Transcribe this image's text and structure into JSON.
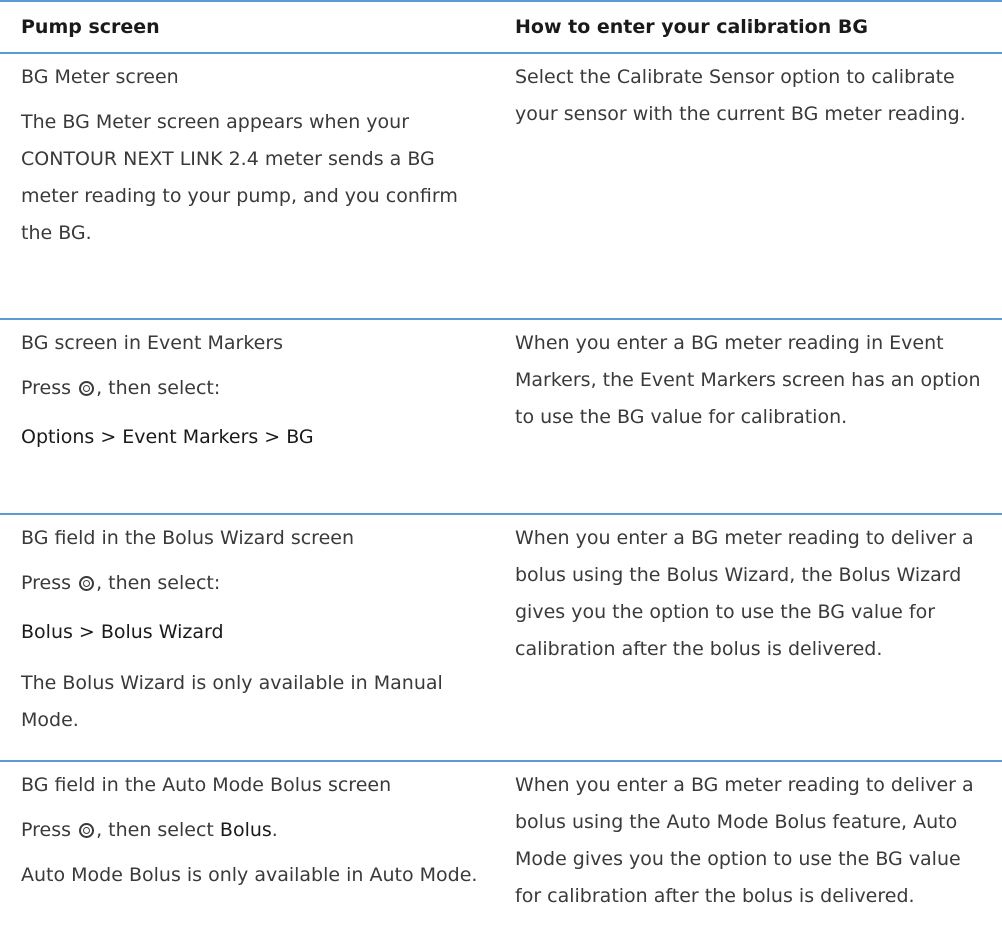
{
  "header": {
    "col_left": "Pump screen",
    "col_right": "How to enter your calibration BG"
  },
  "rows": [
    {
      "left": {
        "title": "BG Meter screen",
        "text": "The BG Meter screen appears when your CONTOUR NEXT LINK 2.4 meter sends a BG meter reading to your pump, and you confirm the BG."
      },
      "right": "Select the Calibrate Sensor option to calibrate your sensor with the current BG meter reading."
    },
    {
      "left": {
        "title": "BG screen in Event Markers",
        "press_before": "Press",
        "press_after": ", then select:",
        "path": [
          "Options",
          "Event Markers",
          "BG"
        ],
        "path_separator": ">"
      },
      "right": "When you enter a BG meter reading in Event Markers, the Event Markers screen has an option to use the BG value for calibration."
    },
    {
      "left": {
        "title": "BG field in the Bolus Wizard screen",
        "press_before": "Press",
        "press_after": ", then select:",
        "path": [
          "Bolus",
          "Bolus Wizard"
        ],
        "path_separator": ">",
        "note": "The Bolus Wizard is only available in Manual Mode."
      },
      "right": "When you enter a BG meter reading to deliver a bolus using the Bolus Wizard, the Bolus Wizard gives you the option to use the BG value for calibration after the bolus is delivered."
    },
    {
      "left": {
        "title": "BG field in the Auto Mode Bolus screen",
        "press_before": "Press",
        "press_mid": ", then select",
        "press_target": "Bolus",
        "press_end": ".",
        "note": "Auto Mode Bolus is only available in Auto Mode."
      },
      "right": "When you enter a BG meter reading to deliver a bolus using the Auto Mode Bolus feature, Auto Mode gives you the option to use the BG value for calibration after the bolus is delivered."
    }
  ],
  "icons": {
    "select_button": "select-button-icon"
  },
  "colors": {
    "rule": "#5b9bd5",
    "text": "#3a3a3a",
    "strong_text": "#1a1a1a"
  }
}
